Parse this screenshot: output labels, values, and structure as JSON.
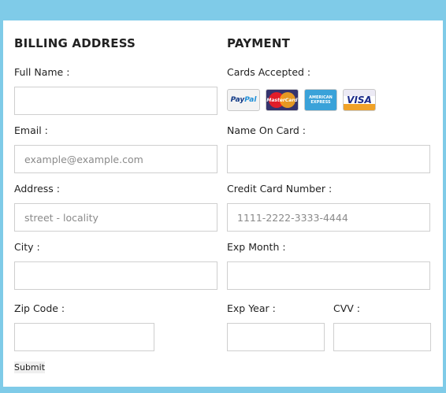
{
  "billing": {
    "title": "BILLING ADDRESS",
    "full_name_label": "Full Name :",
    "full_name_value": "",
    "email_label": "Email :",
    "email_placeholder": "example@example.com",
    "address_label": "Address :",
    "address_placeholder": "street - locality",
    "city_label": "City :",
    "city_value": "",
    "zip_label": "Zip Code :",
    "zip_value": ""
  },
  "payment": {
    "title": "PAYMENT",
    "cards_label": "Cards Accepted :",
    "cards": [
      {
        "name": "PayPal",
        "icon": "paypal-icon"
      },
      {
        "name": "MasterCard",
        "icon": "mastercard-icon"
      },
      {
        "name": "AMERICAN EXPRESS",
        "icon": "amex-icon"
      },
      {
        "name": "VISA",
        "icon": "visa-icon"
      }
    ],
    "name_on_card_label": "Name On Card :",
    "name_on_card_value": "",
    "card_number_label": "Credit Card Number :",
    "card_number_placeholder": "1111-2222-3333-4444",
    "exp_month_label": "Exp Month :",
    "exp_month_value": "",
    "exp_year_label": "Exp Year :",
    "exp_year_value": "",
    "cvv_label": "CVV :",
    "cvv_value": ""
  },
  "actions": {
    "submit_label": "Submit"
  },
  "colors": {
    "page_background": "#7fcbe8",
    "card_background": "#ffffff",
    "field_border": "#cfcfcf"
  }
}
